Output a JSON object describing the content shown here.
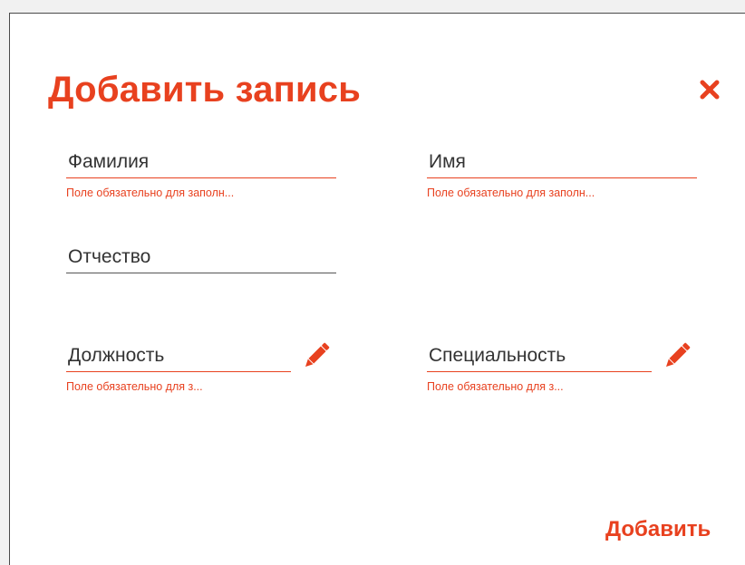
{
  "dialog": {
    "title": "Добавить запись",
    "close_icon": "close-icon",
    "add_label": "Добавить",
    "accent_color": "#e8411f"
  },
  "fields": {
    "last_name": {
      "placeholder": "Фамилия",
      "value": "",
      "error": "Поле обязательно для заполн..."
    },
    "first_name": {
      "placeholder": "Имя",
      "value": "",
      "error": "Поле обязательно для заполн..."
    },
    "patronymic": {
      "placeholder": "Отчество",
      "value": ""
    },
    "position": {
      "placeholder": "Должность",
      "value": "",
      "error": "Поле обязательно для з...",
      "edit_icon": "pencil-icon"
    },
    "specialty": {
      "placeholder": "Специальность",
      "value": "",
      "error": "Поле обязательно для з...",
      "edit_icon": "pencil-icon"
    }
  }
}
